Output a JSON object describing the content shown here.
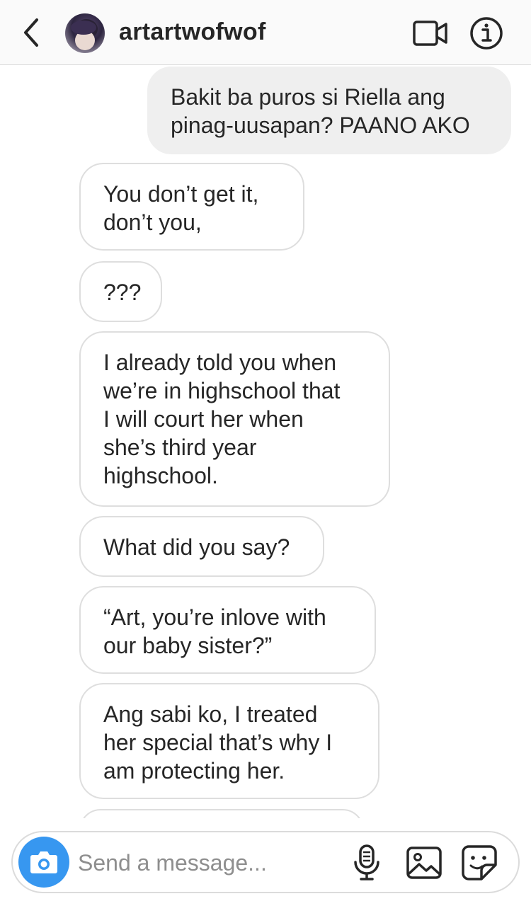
{
  "header": {
    "username": "artartwofwof",
    "back_icon": "chevron-left-icon",
    "video_icon": "video-camera-icon",
    "info_icon": "info-icon"
  },
  "messages": [
    {
      "type": "sent",
      "text": "Bakit ba puros si Riella ang\npinag-uusapan? PAANO AKO"
    },
    {
      "type": "received",
      "text": "You don’t get it,\ndon’t you,"
    },
    {
      "type": "received",
      "text": "???"
    },
    {
      "type": "received",
      "text": "I already told you when\nwe’re in highschool that\nI will court her when\nshe’s third year\nhighschool."
    },
    {
      "type": "received",
      "text": "What did you say?"
    },
    {
      "type": "received",
      "text": "“Art, you’re inlove with\nour baby sister?”"
    },
    {
      "type": "received",
      "text": "Ang sabi ko, I treated\nher special that’s why I\nam protecting her."
    }
  ],
  "composer": {
    "placeholder": "Send a message...",
    "value": "",
    "camera_icon": "camera-icon",
    "mic_icon": "microphone-icon",
    "gallery_icon": "image-icon",
    "sticker_icon": "sticker-icon"
  },
  "colors": {
    "accent": "#3797f0",
    "sent_bubble": "#efefef",
    "received_border": "#dedede",
    "text": "#262626",
    "placeholder": "#8e8e8e"
  }
}
